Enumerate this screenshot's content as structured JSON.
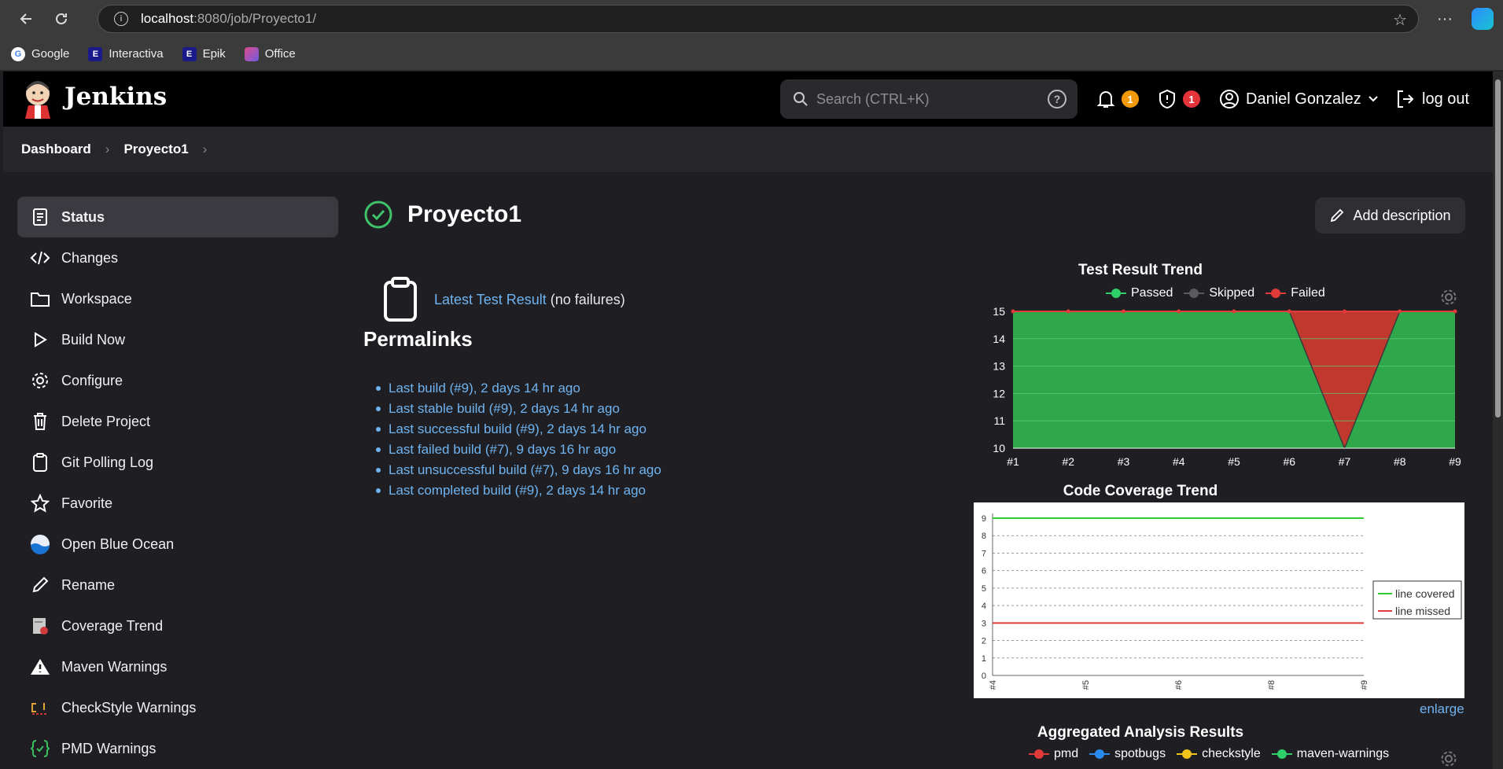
{
  "browser": {
    "url_host": "localhost",
    "url_path": ":8080/job/Proyecto1/",
    "bookmarks": [
      "Google",
      "Interactiva",
      "Epik",
      "Office"
    ]
  },
  "header": {
    "title": "Jenkins",
    "search_placeholder": "Search (CTRL+K)",
    "notifications_count": "1",
    "security_count": "1",
    "user_name": "Daniel Gonzalez",
    "logout_label": "log out"
  },
  "breadcrumb": [
    "Dashboard",
    "Proyecto1"
  ],
  "sidebar": {
    "items": [
      {
        "label": "Status",
        "icon": "document-icon"
      },
      {
        "label": "Changes",
        "icon": "code-icon"
      },
      {
        "label": "Workspace",
        "icon": "folder-icon"
      },
      {
        "label": "Build Now",
        "icon": "play-icon"
      },
      {
        "label": "Configure",
        "icon": "gear-icon"
      },
      {
        "label": "Delete Project",
        "icon": "trash-icon"
      },
      {
        "label": "Git Polling Log",
        "icon": "clipboard-icon"
      },
      {
        "label": "Favorite",
        "icon": "star-icon"
      },
      {
        "label": "Open Blue Ocean",
        "icon": "blue-ocean-icon"
      },
      {
        "label": "Rename",
        "icon": "pencil-icon"
      },
      {
        "label": "Coverage Trend",
        "icon": "coverage-icon"
      },
      {
        "label": "Maven Warnings",
        "icon": "warning-icon"
      },
      {
        "label": "CheckStyle Warnings",
        "icon": "checkstyle-icon"
      },
      {
        "label": "PMD Warnings",
        "icon": "pmd-icon"
      }
    ]
  },
  "main": {
    "title": "Proyecto1",
    "add_description": "Add description",
    "latest_test_link": "Latest Test Result",
    "latest_test_note": "(no failures)",
    "permalinks_title": "Permalinks",
    "permalinks": [
      "Last build (#9), 2 days 14 hr ago",
      "Last stable build (#9), 2 days 14 hr ago",
      "Last successful build (#9), 2 days 14 hr ago",
      "Last failed build (#7), 9 days 16 hr ago",
      "Last unsuccessful build (#7), 9 days 16 hr ago",
      "Last completed build (#9), 2 days 14 hr ago"
    ],
    "enlarge": "enlarge"
  },
  "colors": {
    "passed": "#2ea84a",
    "skipped": "#5b5b5f",
    "failed": "#e03a3a",
    "link": "#6fb3f0"
  },
  "chart_data": [
    {
      "type": "area",
      "title": "Test Result Trend",
      "categories": [
        "#1",
        "#2",
        "#3",
        "#4",
        "#5",
        "#6",
        "#7",
        "#8",
        "#9"
      ],
      "series": [
        {
          "name": "Passed",
          "values": [
            15,
            15,
            15,
            15,
            15,
            15,
            10,
            15,
            15
          ]
        },
        {
          "name": "Skipped",
          "values": [
            0,
            0,
            0,
            0,
            0,
            0,
            0,
            0,
            0
          ]
        },
        {
          "name": "Failed",
          "values": [
            0,
            0,
            0,
            0,
            0,
            0,
            5,
            0,
            0
          ]
        }
      ],
      "ylim": [
        10,
        15
      ],
      "yticks": [
        10,
        11,
        12,
        13,
        14,
        15
      ],
      "legend": "top"
    },
    {
      "type": "line",
      "title": "Code Coverage Trend",
      "categories": [
        "#4",
        "#5",
        "#6",
        "#8",
        "#9"
      ],
      "series": [
        {
          "name": "line covered",
          "values": [
            9,
            9,
            9,
            9,
            9
          ]
        },
        {
          "name": "line missed",
          "values": [
            3,
            3,
            3,
            3,
            3
          ]
        }
      ],
      "ylim": [
        0,
        9
      ],
      "yticks": [
        0,
        1,
        2,
        3,
        4,
        5,
        6,
        7,
        8,
        9
      ],
      "legend": "right"
    },
    {
      "type": "area",
      "title": "Aggregated Analysis Results",
      "series": [
        {
          "name": "pmd"
        },
        {
          "name": "spotbugs"
        },
        {
          "name": "checkstyle"
        },
        {
          "name": "maven-warnings"
        }
      ],
      "legend": "top"
    }
  ]
}
